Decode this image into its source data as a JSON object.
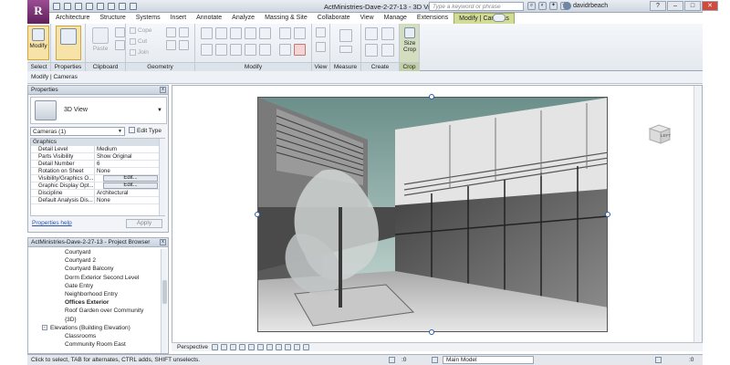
{
  "app": {
    "logo_letter": "R",
    "window_title": "ActMinistries-Dave-2-27-13 - 3D View: Offices Exterior",
    "search_placeholder": "Type a keyword or phrase",
    "username": "davidrbeach",
    "accent_color": "#d2dc97",
    "brand_color": "#7b3a76"
  },
  "ribbon": {
    "tabs": [
      "Architecture",
      "Structure",
      "Systems",
      "Insert",
      "Annotate",
      "Analyze",
      "Massing & Site",
      "Collaborate",
      "View",
      "Manage",
      "Extensions",
      "Modify | Cameras"
    ],
    "active_tab": "Modify | Cameras",
    "groups": {
      "select": "Select",
      "properties": "Properties",
      "clipboard": "Clipboard",
      "geometry": "Geometry",
      "modify": "Modify",
      "view": "View",
      "measure": "Measure",
      "create": "Create",
      "crop": "Crop"
    },
    "buttons": {
      "modify": "Modify",
      "paste": "Paste",
      "cope": "Cope",
      "cut": "Cut",
      "join": "Join",
      "size_crop_1": "Size",
      "size_crop_2": "Crop"
    },
    "context_label": "Modify | Cameras"
  },
  "properties": {
    "title": "Properties",
    "type_name": "3D View",
    "instance": "Cameras (1)",
    "edit_type": "Edit Type",
    "group": "Graphics",
    "rows": [
      {
        "key": "Detail Level",
        "value": "Medium"
      },
      {
        "key": "Parts Visibility",
        "value": "Show Original"
      },
      {
        "key": "Detail Number",
        "value": "6"
      },
      {
        "key": "Rotation on Sheet",
        "value": "None"
      },
      {
        "key": "Visibility/Graphics O...",
        "value": "Edit..."
      },
      {
        "key": "Graphic Display Opt...",
        "value": "Edit..."
      },
      {
        "key": "Discipline",
        "value": "Architectural"
      },
      {
        "key": "Default Analysis Dis...",
        "value": "None"
      }
    ],
    "help_link": "Properties help",
    "apply": "Apply"
  },
  "browser": {
    "title": "ActMinistries-Dave-2-27-13 - Project Browser",
    "items": [
      {
        "label": "Courtyard",
        "level": 2,
        "bold": false
      },
      {
        "label": "Courtyard 2",
        "level": 2,
        "bold": false
      },
      {
        "label": "Courtyard Balcony",
        "level": 2,
        "bold": false
      },
      {
        "label": "Dorm Exterior Second Level",
        "level": 2,
        "bold": false
      },
      {
        "label": "Gate Entry",
        "level": 2,
        "bold": false
      },
      {
        "label": "Neighborhood Entry",
        "level": 2,
        "bold": false
      },
      {
        "label": "Offices Exterior",
        "level": 2,
        "bold": true
      },
      {
        "label": "Roof Garden over Community",
        "level": 2,
        "bold": false
      },
      {
        "label": "{3D}",
        "level": 2,
        "bold": false
      },
      {
        "label": "Elevations (Building Elevation)",
        "level": 1,
        "bold": false
      },
      {
        "label": "Classrooms",
        "level": 2,
        "bold": false
      },
      {
        "label": "Community Room East",
        "level": 2,
        "bold": false
      }
    ]
  },
  "view": {
    "view_control_label": "Perspective",
    "viewcube_label": "LEFT"
  },
  "status": {
    "message": "Click to select, TAB for alternates, CTRL adds, SHIFT unselects.",
    "count": ":0",
    "model": "Main Model"
  }
}
